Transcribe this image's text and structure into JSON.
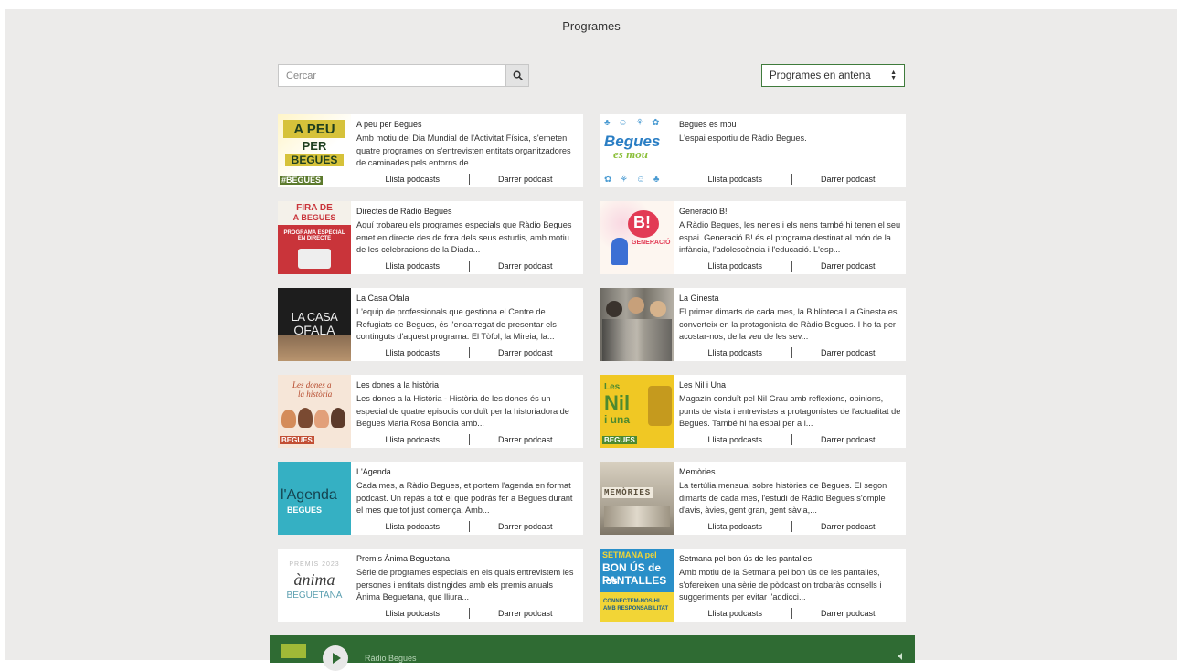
{
  "header": {
    "title": "Programes"
  },
  "search": {
    "placeholder": "Cercar",
    "icon": "search-icon"
  },
  "filter": {
    "selected": "Programes en antena"
  },
  "link_labels": {
    "list": "Llista podcasts",
    "last": "Darrer podcast"
  },
  "programs": [
    {
      "name": "A peu per Begues",
      "desc": "Amb motiu del Dia Mundial de l'Activitat Física, s'emeten quatre programes on s'entrevisten entitats organitzadores de caminades pels entorns de..."
    },
    {
      "name": "Begues es mou",
      "desc": "L'espai esportiu de Ràdio Begues."
    },
    {
      "name": "Directes de Ràdio Begues",
      "desc": "Aquí trobareu els programes especials que Ràdio Begues emet en directe des de fora dels seus estudis, amb motiu de les celebracions de la Diada..."
    },
    {
      "name": "Generació B!",
      "desc": "A Ràdio Begues, les nenes i els nens també hi tenen el seu espai. Generació B! és el programa destinat al món de la infància, l'adolescència i l'educació. L'esp..."
    },
    {
      "name": "La Casa Ofala",
      "desc": "L'equip de professionals que gestiona el Centre de Refugiats de Begues, és l'encarregat de presentar els continguts d'aquest programa. El Tòfol, la Mireia, la..."
    },
    {
      "name": "La Ginesta",
      "desc": "El primer dimarts de cada mes, la Biblioteca La Ginesta es converteix en la protagonista de Ràdio Begues. I ho fa per acostar-nos, de la veu de les sev..."
    },
    {
      "name": "Les dones a la història",
      "desc": "Les dones a la Història - Història de les dones és un especial de quatre episodis conduït per la historiadora de Begues Maria Rosa Bondia amb..."
    },
    {
      "name": "Les Nil i Una",
      "desc": "Magazín conduït pel Nil Grau amb reflexions, opinions, punts de vista i entrevistes a protagonistes de l'actualitat de Begues. També hi ha espai per a l..."
    },
    {
      "name": "L'Agenda",
      "desc": "Cada mes, a Ràdio Begues, et portem l'agenda en format podcast. Un repàs a tot el que podràs fer a Begues durant el mes que tot just comença. Amb..."
    },
    {
      "name": "Memòries",
      "desc": "La tertúlia mensual sobre històries de Begues. El segon dimarts de cada mes, l'estudi de Ràdio Begues s'omple d'avis, àvies, gent gran, gent sàvia,..."
    },
    {
      "name": "Premis Ànima Beguetana",
      "desc": "Sèrie de programes especials en els quals entrevistem les persones i entitats distingides amb els premis anuals Ànima Beguetana, que lliura..."
    },
    {
      "name": "Setmana pel bon ús de les pantalles",
      "desc": "Amb motiu de la Setmana pel bon ús de les pantalles, s'ofereixen una sèrie de pòdcast on trobaràs consells i suggeriments per evitar l'addicci..."
    }
  ],
  "thumbs": {
    "t0": {
      "l1": "A PEU",
      "l2": "PER",
      "l3": "BEGUES",
      "l4": "#BEGUES"
    },
    "t1": {
      "l1": "Begues",
      "l2": "es mou"
    },
    "t2": {
      "l1": "FIRA DE",
      "l2": "A BEGUES",
      "l3": "PROGRAMA ESPECIAL EN DIRECTE"
    },
    "t3": {
      "l1": "B!",
      "l2": "GENERACIÓ"
    },
    "t4": {
      "l1": "LA CASA",
      "l2": "OFALA"
    },
    "t6": {
      "l1": "Les dones a",
      "l2": "la història",
      "l3": "BEGUES"
    },
    "t7": {
      "l1": "Les",
      "l2": "Nil",
      "l3": "i una",
      "l4": "BEGUES"
    },
    "t8": {
      "l1": "l'Agenda",
      "l2": "BEGUES"
    },
    "t9": {
      "l1": "MEMÒRIES"
    },
    "t10": {
      "l1": "PREMIS 2023",
      "l2": "ànima",
      "l3": "BEGUETANA"
    },
    "t11": {
      "l1": "SETMANA pel",
      "l2": "BON ÚS de les",
      "l3": "PANTALLES",
      "l4": "CONNECTEM-NOS-HI AMB RESPONSABILITAT"
    }
  },
  "player": {
    "title": "Ràdio Begues"
  },
  "colors": {
    "accent": "#2f6b33",
    "background": "#ecebea"
  }
}
